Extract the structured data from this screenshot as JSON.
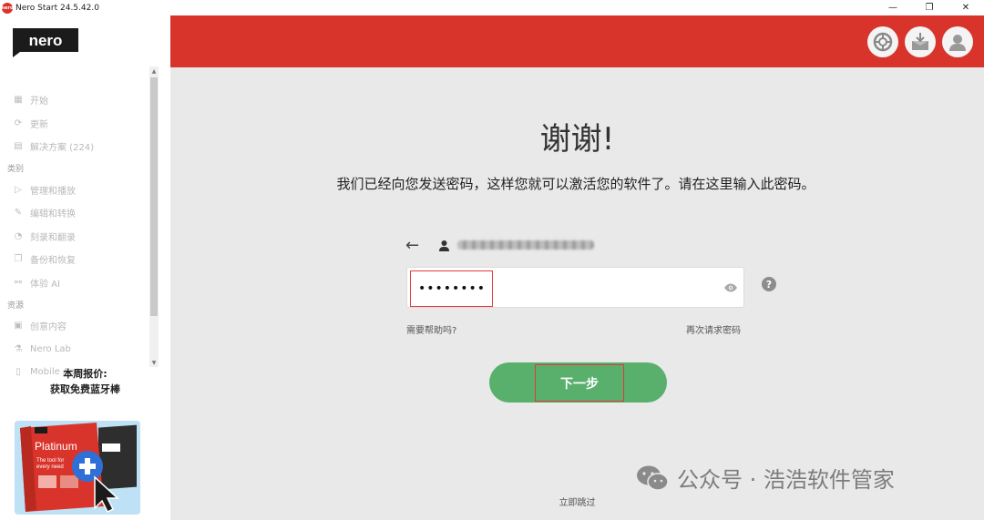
{
  "window": {
    "title": "Nero Start 24.5.42.0",
    "controls": {
      "minimize": "—",
      "restore": "❐",
      "close": "✕"
    }
  },
  "sidebar": {
    "logo": "nero",
    "items": [
      {
        "label": "开始",
        "icon": "grid-icon"
      },
      {
        "label": "更新",
        "icon": "refresh-icon"
      },
      {
        "label": "解决方案 (224)",
        "icon": "solutions-icon"
      }
    ],
    "sections": [
      {
        "title": "类别",
        "items": [
          {
            "label": "管理和播放",
            "icon": "play-icon"
          },
          {
            "label": "编辑和转换",
            "icon": "edit-icon"
          },
          {
            "label": "刻录和翻录",
            "icon": "burn-icon"
          },
          {
            "label": "备份和恢复",
            "icon": "backup-icon"
          },
          {
            "label": "体验 AI",
            "icon": "ai-icon"
          }
        ]
      },
      {
        "title": "资源",
        "items": [
          {
            "label": "创意内容",
            "icon": "creative-icon"
          },
          {
            "label": "Nero Lab",
            "icon": "lab-icon"
          },
          {
            "label": "Mobile Apps",
            "icon": "mobile-icon"
          }
        ]
      }
    ],
    "promo": {
      "line1": "本周报价:",
      "line2": "获取免费蓝牙棒",
      "box_brand": "nero",
      "box_title": "Platinum",
      "box_tagline": "The tool for every need"
    }
  },
  "main": {
    "header_color": "#d9342b",
    "thanks": "谢谢!",
    "message": "我们已经向您发送密码，这样您就可以激活您的软件了。请在这里输入此密码。",
    "password_value": "••••••••",
    "help_link": "需要帮助吗?",
    "resend_link": "再次请求密码",
    "next_button": "下一步",
    "skip_link": "立即跳过",
    "watermark": "公众号 · 浩浩软件管家",
    "accent_green": "#58b06c"
  }
}
